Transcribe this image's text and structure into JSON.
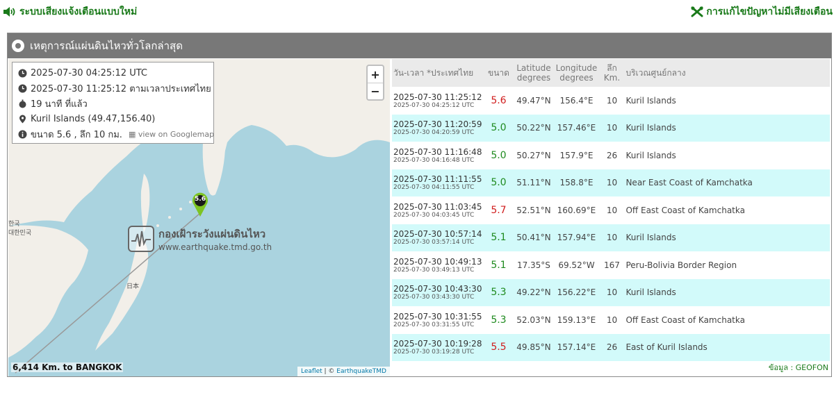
{
  "topbar": {
    "left_link": "ระบบเสียงแจ้งเตือนแบบใหม่",
    "right_link": "การแก้ไขปัญหาไม่มีเสียงเตือน",
    "color": "#1a7a1a"
  },
  "panel": {
    "title": "เหตุการณ์แผ่นดินไหวทั่วโลกล่าสุด"
  },
  "infobox": {
    "utc_time": "2025-07-30 04:25:12 UTC",
    "local_time": "2025-07-30 11:25:12 ตามเวลาประเทศไทย",
    "elapsed": "19 นาที ที่แล้ว",
    "location": "Kuril Islands (49.47,156.40)",
    "magnitude_depth": "ขนาด 5.6 , ลึก 10 กม.",
    "googlemap_link": "view on Googlemap"
  },
  "map": {
    "marker_label": "5.6",
    "distance": "6,414 Km. to BANGKOK",
    "zoom_in": "+",
    "zoom_out": "−",
    "attrib_leaflet": "Leaflet",
    "attrib_sep": " | © ",
    "attrib_owner": "EarthquakeTMD",
    "watermark_title": "กองเฝ้าระวังแผ่นดินไหว",
    "watermark_url": "www.earthquake.tmd.go.th",
    "label_japan": "日本",
    "label_korea1": "한국",
    "label_korea2": "대한민국"
  },
  "table": {
    "headers": {
      "datetime": "วัน-เวลา *ประเทศไทย",
      "magnitude": "ขนาด",
      "lat1": "Latitude",
      "lat2": "degrees",
      "lon1": "Longitude",
      "lon2": "degrees",
      "depth1": "ลึก",
      "depth2": "Km.",
      "region": "บริเวณศูนย์กลาง"
    },
    "rows": [
      {
        "local": "2025-07-30 11:25:12",
        "utc": "2025-07-30 04:25:12 UTC",
        "mag": "5.6",
        "lat": "49.47°N",
        "lon": "156.4°E",
        "depth": "10",
        "region": "Kuril Islands"
      },
      {
        "local": "2025-07-30 11:20:59",
        "utc": "2025-07-30 04:20:59 UTC",
        "mag": "5.0",
        "lat": "50.22°N",
        "lon": "157.46°E",
        "depth": "10",
        "region": "Kuril Islands"
      },
      {
        "local": "2025-07-30 11:16:48",
        "utc": "2025-07-30 04:16:48 UTC",
        "mag": "5.0",
        "lat": "50.27°N",
        "lon": "157.9°E",
        "depth": "26",
        "region": "Kuril Islands"
      },
      {
        "local": "2025-07-30 11:11:55",
        "utc": "2025-07-30 04:11:55 UTC",
        "mag": "5.0",
        "lat": "51.11°N",
        "lon": "158.8°E",
        "depth": "10",
        "region": "Near East Coast of Kamchatka"
      },
      {
        "local": "2025-07-30 11:03:45",
        "utc": "2025-07-30 04:03:45 UTC",
        "mag": "5.7",
        "lat": "52.51°N",
        "lon": "160.69°E",
        "depth": "10",
        "region": "Off East Coast of Kamchatka"
      },
      {
        "local": "2025-07-30 10:57:14",
        "utc": "2025-07-30 03:57:14 UTC",
        "mag": "5.1",
        "lat": "50.41°N",
        "lon": "157.94°E",
        "depth": "10",
        "region": "Kuril Islands"
      },
      {
        "local": "2025-07-30 10:49:13",
        "utc": "2025-07-30 03:49:13 UTC",
        "mag": "5.1",
        "lat": "17.35°S",
        "lon": "69.52°W",
        "depth": "167",
        "region": "Peru-Bolivia Border Region"
      },
      {
        "local": "2025-07-30 10:43:30",
        "utc": "2025-07-30 03:43:30 UTC",
        "mag": "5.3",
        "lat": "49.22°N",
        "lon": "156.22°E",
        "depth": "10",
        "region": "Kuril Islands"
      },
      {
        "local": "2025-07-30 10:31:55",
        "utc": "2025-07-30 03:31:55 UTC",
        "mag": "5.3",
        "lat": "52.03°N",
        "lon": "159.13°E",
        "depth": "10",
        "region": "Off East Coast of Kamchatka"
      },
      {
        "local": "2025-07-30 10:19:28",
        "utc": "2025-07-30 03:19:28 UTC",
        "mag": "5.5",
        "lat": "49.85°N",
        "lon": "157.14°E",
        "depth": "26",
        "region": "East of Kuril Islands"
      }
    ],
    "source": "ข้อมูล : GEOFON",
    "colors": {
      "high": "#d01c1c",
      "normal": "#1e8a1e",
      "alt_row": "#d2fafa"
    }
  }
}
